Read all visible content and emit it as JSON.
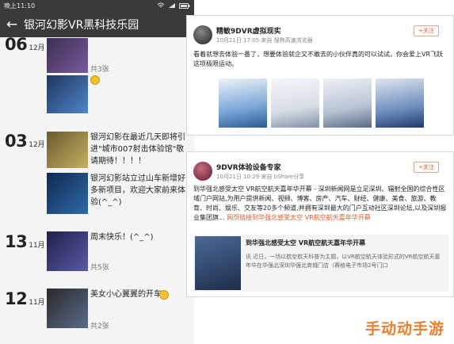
{
  "status_bar": {
    "time": "晚上11:10"
  },
  "header": {
    "back": "←",
    "title": "银河幻影VR黑科技乐园"
  },
  "feed": [
    {
      "day": "06",
      "month": "12月",
      "text": "",
      "count": "共3张"
    },
    {
      "day": "03",
      "month": "12月",
      "text": "银河幻影在最近几天即将引进\"城市007射击体验馆\"敬请期待！！！！",
      "text2": "银河幻影站立过山车新增好多新项目，欢迎大家前来体验(^_^)",
      "count": ""
    },
    {
      "day": "13",
      "month": "11月",
      "text": "周末快乐！(^_^)",
      "count": "共5张"
    },
    {
      "day": "12",
      "month": "11月",
      "text": "美女小心翼翼的开车",
      "count": "共2张"
    }
  ],
  "posts": [
    {
      "author": "精敏9DVR虚拟现实",
      "meta": "10月21日 17:05 来自 搜狗高速浏览器",
      "follow": "+关注",
      "text": "看着就想去体验一番了，想要体验就企又不敢去的小伙伴真的可以试试，你会爱上VR飞跃这项极限运动。"
    },
    {
      "author": "9DVR体验设备专家",
      "meta": "10月21日 10:29 来自 bShare分享",
      "follow": "+关注",
      "text": "到华强北感受太空 VR航空航天嘉年华开幕 - 深圳新闻网是立足深圳、辐射全国的综合性区域门户网站,为用户提供新闻、视频、博客、房产、汽车、财经、健康、美食、旅游、教育、时尚、娱乐、交友等20多个频道,并拥有深圳最大的门户互动社区深圳论坛,以及深圳报业集团旗...",
      "link": "网页链接到华强北感受太空 VR航空航天嘉年华开幕",
      "sub_title": "到华强北感受太空 VR航空航天嘉年华开幕",
      "sub_desc": "讯 近日，一场以航空航天科普为主题，以VR航空航天体验形式的VR航空航天嘉年华在华强北深圳华强北商城门店（赛格电子市场2号门口"
    }
  ],
  "watermark": "手动动手游"
}
